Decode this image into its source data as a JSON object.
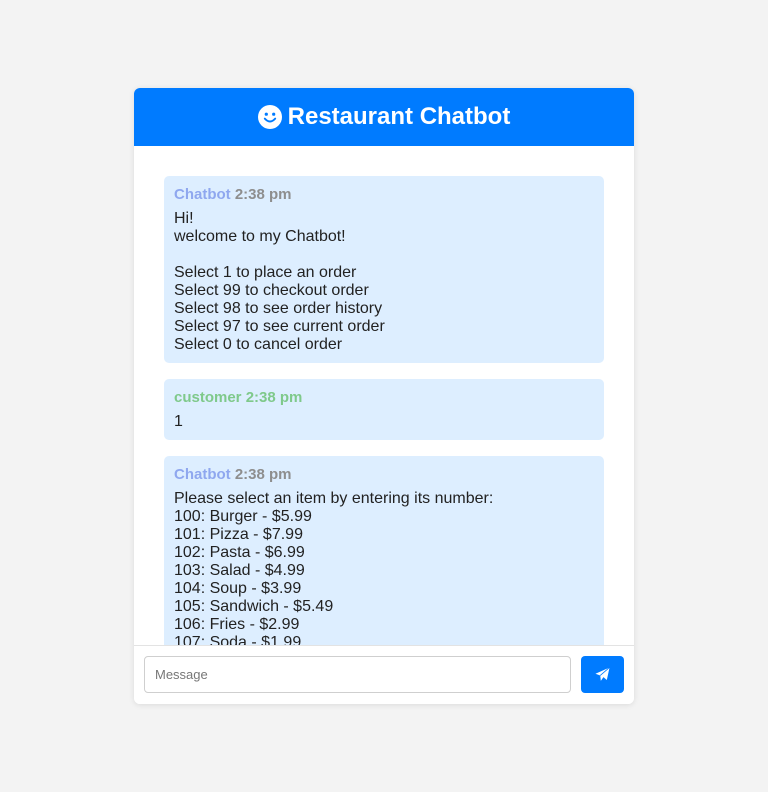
{
  "header": {
    "title": "Restaurant Chatbot",
    "icon": "smiley-icon"
  },
  "colors": {
    "accent": "#007bff",
    "bubble": "#ddeeff",
    "bot_name": "#8fa7ef",
    "customer_name": "#7fc98b"
  },
  "messages": [
    {
      "sender": "Chatbot",
      "time": "2:38 pm",
      "lines": [
        "Hi!",
        "welcome to my Chatbot!",
        "",
        "Select 1 to place an order",
        "Select 99 to checkout order",
        "Select 98 to see order history",
        "Select 97 to see current order",
        "Select 0 to cancel order"
      ]
    },
    {
      "sender": "customer",
      "time": "2:38 pm",
      "lines": [
        "1"
      ]
    },
    {
      "sender": "Chatbot",
      "time": "2:38 pm",
      "lines": [
        "Please select an item by entering its number:",
        "100: Burger - $5.99",
        "101: Pizza - $7.99",
        "102: Pasta - $6.99",
        "103: Salad - $4.99",
        "104: Soup - $3.99",
        "105: Sandwich - $5.49",
        "106: Fries - $2.99",
        "107: Soda - $1.99"
      ]
    }
  ],
  "composer": {
    "placeholder": "Message",
    "value": "",
    "send_icon": "send-icon"
  }
}
